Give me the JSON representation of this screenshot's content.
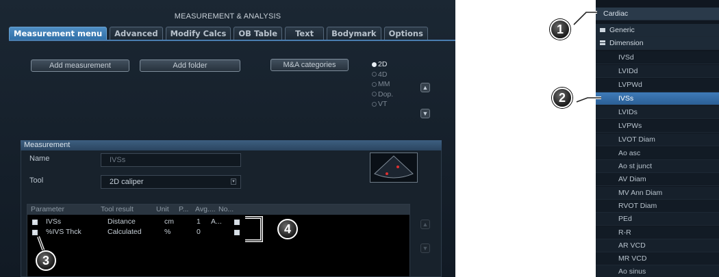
{
  "window": {
    "title": "MEASUREMENT & ANALYSIS"
  },
  "tabs": [
    "Measurement menu",
    "Advanced",
    "Modify Calcs",
    "OB Table",
    "Text",
    "Bodymark",
    "Options"
  ],
  "toolbar": {
    "add_measurement": "Add measurement",
    "add_folder": "Add folder",
    "ma_categories": "M&A categories"
  },
  "modes": {
    "options": [
      "2D",
      "4D",
      "MM",
      "Dop.",
      "VT"
    ],
    "selected": "2D"
  },
  "measurement": {
    "section_title": "Measurement",
    "name_label": "Name",
    "name_value": "IVSs",
    "tool_label": "Tool",
    "tool_value": "2D caliper"
  },
  "param_table": {
    "headers": [
      "Parameter",
      "Tool result",
      "Unit",
      "P...",
      "Avg....",
      "No..."
    ],
    "rows": [
      {
        "checked": true,
        "parameter": "IVSs",
        "tool_result": "Distance",
        "unit": "cm",
        "p": "1",
        "avg": "A...",
        "normal": true
      },
      {
        "checked": true,
        "parameter": "%IVS Thck",
        "tool_result": "Calculated",
        "unit": "%",
        "p": "0",
        "avg": "",
        "normal": true
      }
    ]
  },
  "sidebar": {
    "category": "Cardiac",
    "folders": [
      {
        "label": "Generic",
        "open": false
      },
      {
        "label": "Dimension",
        "open": true
      }
    ],
    "items": [
      "IVSd",
      "LVIDd",
      "LVPWd",
      "IVSs",
      "LVIDs",
      "LVPWs",
      "LVOT Diam",
      "Ao asc",
      "Ao st junct",
      "AV Diam",
      "MV Ann Diam",
      "RVOT Diam",
      "PEd",
      "R-R",
      "AR VCD",
      "MR VCD",
      "Ao sinus"
    ],
    "selected_item": "IVSs"
  },
  "callouts": [
    "1",
    "2",
    "3",
    "4"
  ],
  "colors": {
    "accent": "#3f7bb8",
    "panel_bg": "#111a24",
    "callout_bg": "#2a2a2a"
  }
}
